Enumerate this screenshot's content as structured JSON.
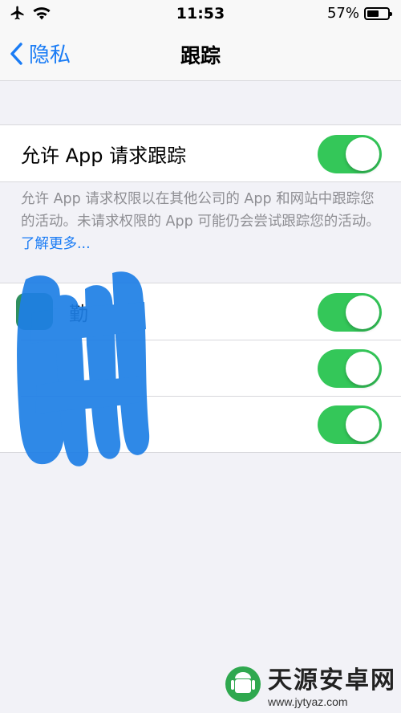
{
  "status_bar": {
    "time": "11:53",
    "battery_percent_text": "57%",
    "battery_level": 0.57,
    "icons": [
      "airplane-icon",
      "wifi-icon",
      "battery-icon"
    ]
  },
  "nav": {
    "back_label": "隐私",
    "title": "跟踪"
  },
  "main_toggle": {
    "label": "允许 App 请求跟踪",
    "on": true
  },
  "footnote": {
    "text": "允许 App 请求权限以在其他公司的 App 和网站中跟踪您的活动。未请求权限的 App 可能仍会尝试跟踪您的活动。",
    "link": "了解更多..."
  },
  "apps": [
    {
      "label": "勤",
      "on": true
    },
    {
      "label": "",
      "on": true
    },
    {
      "label": "",
      "on": true
    }
  ],
  "watermark": {
    "brand": "天源安卓网",
    "url": "www.jytyaz.com"
  },
  "colors": {
    "accent": "#1a7cf5",
    "toggle_on": "#34c759",
    "background": "#f2f2f7",
    "scribble": "#1e7fe6"
  }
}
